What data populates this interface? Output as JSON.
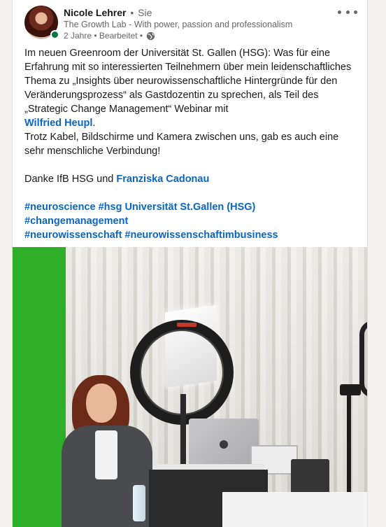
{
  "post": {
    "author": {
      "name": "Nicole Lehrer",
      "relation": "Sie",
      "headline": "The Growth Lab - With power, passion and professionalism",
      "meta": "2 Jahre • Bearbeitet •",
      "visibility_icon": "globe-icon",
      "presence_color": "#057642"
    },
    "more_menu_icon": "ellipsis-icon",
    "text": {
      "para1": "Im neuen Greenroom der Universität St. Gallen (HSG): Was für eine Erfahrung mit so interessierten Teilnehmern über mein leidenschaftliches Thema zu „Insights über neurowissenschaftliche Hintergründe für den Veränderungsprozess“ als Gastdozentin zu sprechen, als Teil des „Strategic Change Management“ Webinar mit",
      "mention1": "Wilfried Heupl",
      "para1_end": ".",
      "para2": "Trotz Kabel, Bildschirme und Kamera zwischen uns, gab es auch eine sehr menschliche Verbindung!",
      "thanks_prefix": "Danke IfB HSG und",
      "mention2": "Franziska Cadonau",
      "hashtags_line1": "#neuroscience #hsg Universität St.Gallen (HSG)",
      "hashtags_line2": "#changemanagement",
      "hashtags_line3": "#neurowissenschaft #neurowissenschaftimbusiness"
    },
    "link_color": "#0a66c2"
  }
}
